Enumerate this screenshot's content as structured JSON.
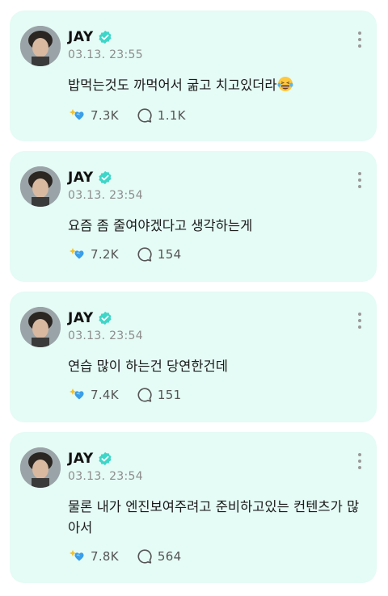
{
  "posts": [
    {
      "author": "JAY",
      "time": "03.13. 23:55",
      "text": "밥먹는것도 까먹어서 굶고 치고있더라",
      "emoji": "laughing-tears",
      "likes": "7.3K",
      "comments": "1.1K"
    },
    {
      "author": "JAY",
      "time": "03.13. 23:54",
      "text": "요즘 좀 줄여야겠다고 생각하는게",
      "likes": "7.2K",
      "comments": "154"
    },
    {
      "author": "JAY",
      "time": "03.13. 23:54",
      "text": "연습 많이 하는건 당연한건데",
      "likes": "7.4K",
      "comments": "151"
    },
    {
      "author": "JAY",
      "time": "03.13. 23:54",
      "text": "물론 내가 엔진보여주려고 준비하고있는 컨텐츠가 많아서",
      "likes": "7.8K",
      "comments": "564"
    }
  ],
  "colors": {
    "card_bg": "#e5fbf5",
    "verified": "#3dd6c8",
    "muted": "#8c8c8c"
  },
  "icons": {
    "verified": "verified-badge-icon",
    "more": "more-vertical-icon",
    "like": "sparkle-heart-icon",
    "comment": "comment-bubble-icon"
  }
}
